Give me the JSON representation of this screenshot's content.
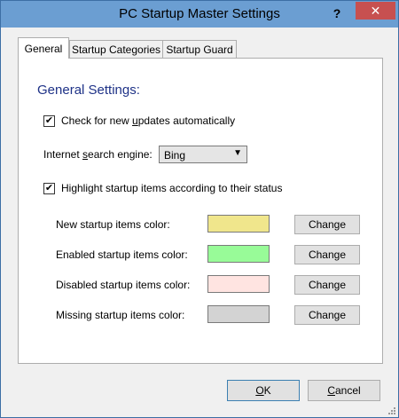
{
  "window": {
    "title": "PC Startup Master Settings",
    "help_label": "?",
    "close_label": "✕"
  },
  "tabs": [
    {
      "label": "General",
      "active": true
    },
    {
      "label": "Startup Categories",
      "active": false
    },
    {
      "label": "Startup Guard",
      "active": false
    }
  ],
  "general": {
    "heading": "General Settings:",
    "check_updates": {
      "label_before": "Check for new ",
      "label_underline": "u",
      "label_after": "pdates automatically",
      "checked": true
    },
    "search_engine": {
      "label_before": "Internet ",
      "label_underline": "s",
      "label_after": "earch engine:",
      "value": "Bing",
      "arrow": "▼"
    },
    "highlight": {
      "label": "Highlight startup items according to their status",
      "checked": true
    },
    "colors": [
      {
        "label": "New startup items color:",
        "color": "#f0e68c",
        "button": "Change"
      },
      {
        "label": "Enabled startup items color:",
        "color": "#98fb98",
        "button": "Change"
      },
      {
        "label": "Disabled startup items color:",
        "color": "#ffe4e1",
        "button": "Change"
      },
      {
        "label": "Missing startup items color:",
        "color": "#d3d3d3",
        "button": "Change"
      }
    ]
  },
  "footer": {
    "ok_label": "OK",
    "ok_underline": "O",
    "ok_rest": "K",
    "cancel_underline": "C",
    "cancel_rest": "ancel"
  },
  "check_mark": "✔"
}
